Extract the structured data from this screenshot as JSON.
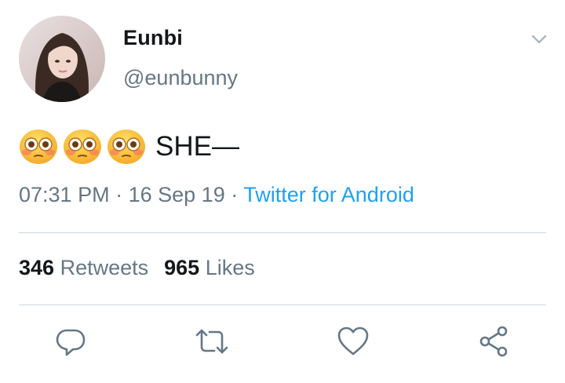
{
  "tweet": {
    "author": {
      "display_name": "Eunbi",
      "handle": "@eunbunny"
    },
    "text": "SHE—",
    "emojis": [
      "flushed-face",
      "flushed-face",
      "flushed-face"
    ],
    "timestamp": {
      "time": "07:31 PM",
      "date": "16 Sep 19",
      "separator": "·",
      "source": "Twitter for Android"
    },
    "stats": {
      "retweets_count": "346",
      "retweets_label": "Retweets",
      "likes_count": "965",
      "likes_label": "Likes"
    },
    "actions": [
      "reply-icon",
      "retweet-icon",
      "like-icon",
      "share-icon"
    ]
  },
  "colors": {
    "text_primary": "#14171a",
    "text_secondary": "#657786",
    "link": "#1da1f2",
    "divider": "#ccd6dd",
    "icon": "#657786"
  }
}
